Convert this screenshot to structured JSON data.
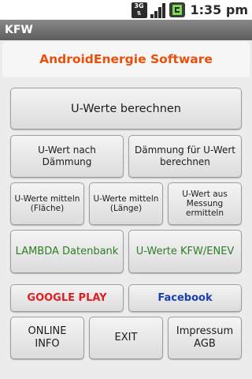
{
  "status_bar": {
    "network_type": "3G",
    "time": "1:35 pm",
    "icons": [
      "network-3g-icon",
      "signal-strength-icon",
      "battery-charging-icon"
    ]
  },
  "app_bar": {
    "title": "KFW"
  },
  "header": {
    "brand": "AndroidEnergie Software",
    "brand_color": "#e8500c"
  },
  "buttons": {
    "u_werte_berechnen": "U-Werte berechnen",
    "u_wert_nach_daemmung": "U-Wert nach Dämmung",
    "daemmung_fuer_u_wert": "Dämmung für U-Wert berechnen",
    "u_werte_mitteln_flaeche": "U-Werte mitteln (Fläche)",
    "u_werte_mitteln_laenge": "U-Werte mitteln (Länge)",
    "u_wert_aus_messung": "U-Wert aus Messung ermitteln",
    "lambda_datenbank": "LAMBDA Datenbank",
    "u_werte_kfw_enev": "U-Werte KFW/ENEV",
    "google_play": "GOOGLE PLAY",
    "facebook": "Facebook",
    "online_info": "ONLINE INFO",
    "exit": "EXIT",
    "impressum_agb": "Impressum AGB"
  },
  "colors": {
    "green_text": "#2e7d27",
    "google_play_text": "#e02020",
    "facebook_text": "#1a3fb0"
  }
}
